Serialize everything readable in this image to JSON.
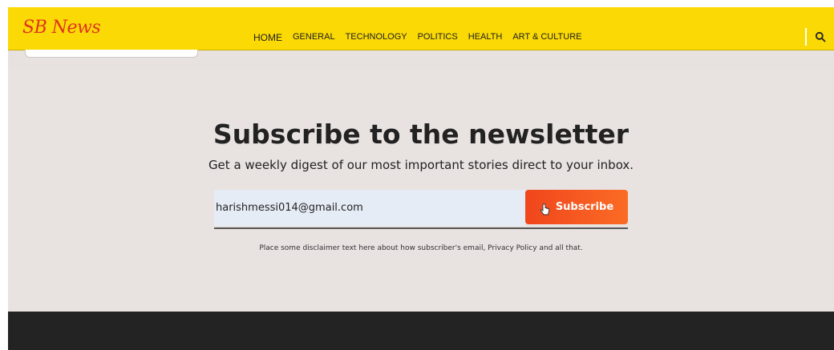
{
  "header": {
    "logo": "SB News",
    "nav": [
      {
        "label": "HOME",
        "active": true
      },
      {
        "label": "GENERAL",
        "active": false
      },
      {
        "label": "TECHNOLOGY",
        "active": false
      },
      {
        "label": "POLITICS",
        "active": false
      },
      {
        "label": "HEALTH",
        "active": false
      },
      {
        "label": "ART & CULTURE",
        "active": false
      }
    ],
    "search_icon": "search-icon"
  },
  "newsletter": {
    "title": "Subscribe to the newsletter",
    "subtitle": "Get a weekly digest of our most important stories direct to your inbox.",
    "email_value": "harishmessi014@gmail.com",
    "button_label": "Subscribe",
    "disclaimer": "Place some disclaimer text here about how subscriber's email, Privacy Policy and all that."
  },
  "colors": {
    "header_bg": "#fbd905",
    "logo": "#e0341e",
    "button": "#f0461c",
    "page_bg": "#e7e1e0",
    "footer_bg": "#232323"
  }
}
